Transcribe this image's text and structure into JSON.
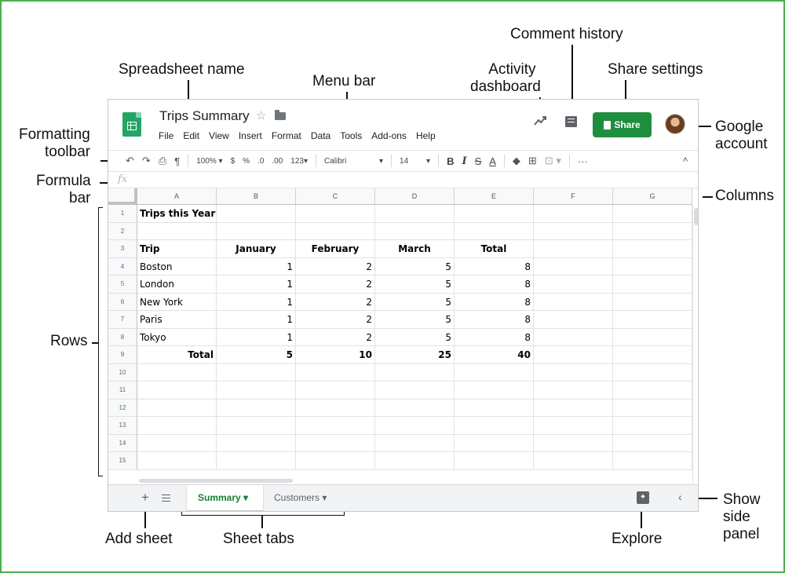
{
  "annotations": {
    "spreadsheet_name": "Spreadsheet name",
    "menu_bar": "Menu bar",
    "activity_dashboard_1": "Activity",
    "activity_dashboard_2": "dashboard",
    "comment_history": "Comment history",
    "share_settings": "Share settings",
    "formatting_toolbar_1": "Formatting",
    "formatting_toolbar_2": "toolbar",
    "formula_bar_1": "Formula",
    "formula_bar_2": "bar",
    "google_account_1": "Google",
    "google_account_2": "account",
    "columns": "Columns",
    "rows": "Rows",
    "add_sheet": "Add sheet",
    "sheet_tabs": "Sheet tabs",
    "explore": "Explore",
    "show_side_panel_1": "Show",
    "show_side_panel_2": "side",
    "show_side_panel_3": "panel"
  },
  "title_bar": {
    "doc_title": "Trips Summary",
    "star_glyph": "☆",
    "share_label": "Share"
  },
  "menu": [
    "File",
    "Edit",
    "View",
    "Insert",
    "Format",
    "Data",
    "Tools",
    "Add-ons",
    "Help"
  ],
  "toolbar": {
    "undo": "↶",
    "redo": "↷",
    "print": "⎙",
    "paint_format": "¶",
    "zoom": "100% ▾",
    "currency": "$",
    "percent": "%",
    "decrease_decimal": ".0",
    "increase_decimal": ".00",
    "more_formats": "123▾",
    "font": "Calibri",
    "font_dropdown": "▾",
    "font_size": "14",
    "font_size_dropdown": "▾",
    "bold": "B",
    "italic": "I",
    "strikethrough": "S",
    "text_color": "A",
    "fill_color": "◆",
    "borders": "⊞",
    "merge": "⊡ ▾",
    "more": "···",
    "collapse": "^"
  },
  "formula_bar": {
    "fx": "fx"
  },
  "columns": [
    "A",
    "B",
    "C",
    "D",
    "E",
    "F",
    "G"
  ],
  "rows": [
    "1",
    "2",
    "3",
    "4",
    "5",
    "6",
    "7",
    "8",
    "9",
    "10",
    "11",
    "12",
    "13",
    "14",
    "15"
  ],
  "cells": {
    "title": "Trips this Year",
    "headers": [
      "Trip",
      "January",
      "February",
      "March",
      "Total"
    ],
    "data": [
      [
        "Boston",
        "1",
        "2",
        "5",
        "8"
      ],
      [
        "London",
        "1",
        "2",
        "5",
        "8"
      ],
      [
        "New York",
        "1",
        "2",
        "5",
        "8"
      ],
      [
        "Paris",
        "1",
        "2",
        "5",
        "8"
      ],
      [
        "Tokyo",
        "1",
        "2",
        "5",
        "8"
      ]
    ],
    "total_row": [
      "Total",
      "5",
      "10",
      "25",
      "40"
    ]
  },
  "sheet_tabs": {
    "add": "+",
    "active": "Summary ▾",
    "inactive": "Customers ▾"
  },
  "side": {
    "explore_glyph": "✦",
    "panel_toggle": "‹"
  },
  "colors": {
    "brand_green": "#1e8e3e",
    "active_tab_green": "#188038",
    "frame_green": "#4caf50"
  }
}
